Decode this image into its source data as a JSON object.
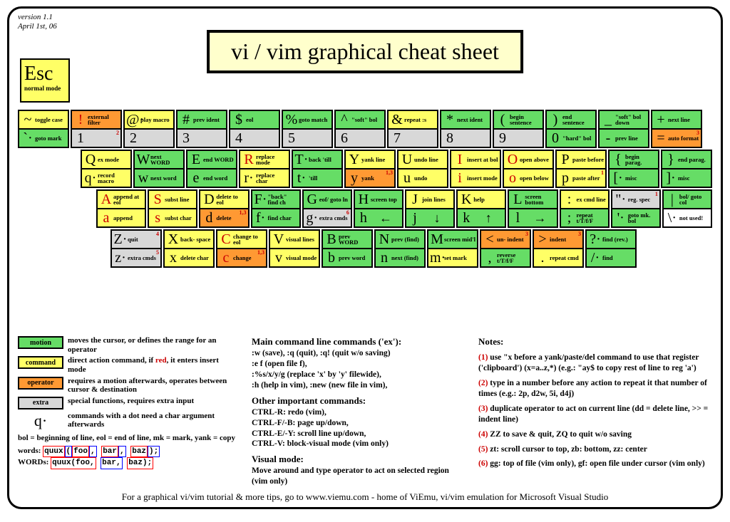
{
  "version": "version 1.1",
  "date": "April 1st, 06",
  "title": "vi / vim graphical cheat sheet",
  "esc": {
    "key": "Esc",
    "label": "normal mode"
  },
  "rows": [
    [
      {
        "t": {
          "ch": "~",
          "d": "toggle case",
          "c": "command"
        },
        "b": {
          "ch": "`·",
          "d": "goto mark",
          "c": "motion"
        }
      },
      {
        "t": {
          "ch": "!",
          "d": "external filter",
          "c": "operator",
          "red": 1
        },
        "b": {
          "ch": "1",
          "d": "",
          "c": "extra",
          "sup": "2"
        }
      },
      {
        "t": {
          "ch": "@·",
          "d": "play macro",
          "c": "command"
        },
        "b": {
          "ch": "2",
          "d": "",
          "c": "extra"
        }
      },
      {
        "t": {
          "ch": "#",
          "d": "prev ident",
          "c": "motion"
        },
        "b": {
          "ch": "3",
          "d": "",
          "c": "extra"
        }
      },
      {
        "t": {
          "ch": "$",
          "d": "eol",
          "c": "motion"
        },
        "b": {
          "ch": "4",
          "d": "",
          "c": "extra"
        }
      },
      {
        "t": {
          "ch": "%",
          "d": "goto match",
          "c": "motion"
        },
        "b": {
          "ch": "5",
          "d": "",
          "c": "extra"
        }
      },
      {
        "t": {
          "ch": "^",
          "d": "\"soft\" bol",
          "c": "motion"
        },
        "b": {
          "ch": "6",
          "d": "",
          "c": "extra"
        }
      },
      {
        "t": {
          "ch": "&",
          "d": "repeat :s",
          "c": "command"
        },
        "b": {
          "ch": "7",
          "d": "",
          "c": "extra"
        }
      },
      {
        "t": {
          "ch": "*",
          "d": "next ident",
          "c": "motion"
        },
        "b": {
          "ch": "8",
          "d": "",
          "c": "extra"
        }
      },
      {
        "t": {
          "ch": "(",
          "d": "begin sentence",
          "c": "motion"
        },
        "b": {
          "ch": "9",
          "d": "",
          "c": "extra"
        }
      },
      {
        "t": {
          "ch": ")",
          "d": "end sentence",
          "c": "motion"
        },
        "b": {
          "ch": "0",
          "d": "\"hard\" bol",
          "c": "motion"
        }
      },
      {
        "t": {
          "ch": "_",
          "d": "\"soft\" bol down",
          "c": "motion"
        },
        "b": {
          "ch": "-",
          "d": "prev line",
          "c": "motion"
        }
      },
      {
        "t": {
          "ch": "+",
          "d": "next line",
          "c": "motion"
        },
        "b": {
          "ch": "=",
          "d": "auto format",
          "c": "operator",
          "sup": "3"
        }
      }
    ],
    [
      {
        "t": {
          "ch": "Q",
          "d": "ex mode",
          "c": "command"
        },
        "b": {
          "ch": "q·",
          "d": "record macro",
          "c": "command"
        }
      },
      {
        "t": {
          "ch": "W",
          "d": "next WORD",
          "c": "motion"
        },
        "b": {
          "ch": "w",
          "d": "next word",
          "c": "motion"
        }
      },
      {
        "t": {
          "ch": "E",
          "d": "end WORD",
          "c": "motion"
        },
        "b": {
          "ch": "e",
          "d": "end word",
          "c": "motion"
        }
      },
      {
        "t": {
          "ch": "R",
          "d": "replace mode",
          "c": "command",
          "red": 1
        },
        "b": {
          "ch": "r·",
          "d": "replace char",
          "c": "command"
        }
      },
      {
        "t": {
          "ch": "T·",
          "d": "back 'till",
          "c": "motion"
        },
        "b": {
          "ch": "t·",
          "d": "'till",
          "c": "motion"
        }
      },
      {
        "t": {
          "ch": "Y",
          "d": "yank line",
          "c": "command"
        },
        "b": {
          "ch": "y",
          "d": "yank",
          "c": "operator",
          "sup": "1,3"
        }
      },
      {
        "t": {
          "ch": "U",
          "d": "undo line",
          "c": "command"
        },
        "b": {
          "ch": "u",
          "d": "undo",
          "c": "command"
        }
      },
      {
        "t": {
          "ch": "I",
          "d": "insert at bol",
          "c": "command",
          "red": 1
        },
        "b": {
          "ch": "i",
          "d": "insert mode",
          "c": "command",
          "red": 1
        }
      },
      {
        "t": {
          "ch": "O",
          "d": "open above",
          "c": "command",
          "red": 1
        },
        "b": {
          "ch": "o",
          "d": "open below",
          "c": "command",
          "red": 1
        }
      },
      {
        "t": {
          "ch": "P",
          "d": "paste before",
          "c": "command"
        },
        "b": {
          "ch": "p",
          "d": "paste after",
          "c": "command",
          "sup": "1"
        }
      },
      {
        "t": {
          "ch": "{",
          "d": "begin parag.",
          "c": "motion"
        },
        "b": {
          "ch": "[·",
          "d": "misc",
          "c": "motion"
        }
      },
      {
        "t": {
          "ch": "}",
          "d": "end parag.",
          "c": "motion"
        },
        "b": {
          "ch": "]·",
          "d": "misc",
          "c": "motion"
        }
      }
    ],
    [
      {
        "t": {
          "ch": "A",
          "d": "append at eol",
          "c": "command",
          "red": 1
        },
        "b": {
          "ch": "a",
          "d": "append",
          "c": "command",
          "red": 1
        }
      },
      {
        "t": {
          "ch": "S",
          "d": "subst line",
          "c": "command",
          "red": 1
        },
        "b": {
          "ch": "s",
          "d": "subst char",
          "c": "command",
          "red": 1
        }
      },
      {
        "t": {
          "ch": "D",
          "d": "delete to eol",
          "c": "command"
        },
        "b": {
          "ch": "d",
          "d": "delete",
          "c": "operator",
          "sup": "1,3"
        }
      },
      {
        "t": {
          "ch": "F·",
          "d": "\"back\" find ch",
          "c": "motion"
        },
        "b": {
          "ch": "f·",
          "d": "find char",
          "c": "motion"
        }
      },
      {
        "t": {
          "ch": "G",
          "d": "eof/ goto ln",
          "c": "motion"
        },
        "b": {
          "ch": "g·",
          "d": "extra cmds",
          "c": "extra",
          "sup": "6"
        }
      },
      {
        "t": {
          "ch": "H",
          "d": "screen top",
          "c": "motion"
        },
        "b": {
          "ch": "h",
          "d": "",
          "c": "motion",
          "arrow": "←"
        }
      },
      {
        "t": {
          "ch": "J",
          "d": "join lines",
          "c": "command"
        },
        "b": {
          "ch": "j",
          "d": "",
          "c": "motion",
          "arrow": "↓"
        }
      },
      {
        "t": {
          "ch": "K",
          "d": "help",
          "c": "command"
        },
        "b": {
          "ch": "k",
          "d": "",
          "c": "motion",
          "arrow": "↑"
        }
      },
      {
        "t": {
          "ch": "L",
          "d": "screen bottom",
          "c": "motion"
        },
        "b": {
          "ch": "l",
          "d": "",
          "c": "motion",
          "arrow": "→"
        }
      },
      {
        "t": {
          "ch": ":",
          "d": "ex cmd line",
          "c": "command"
        },
        "b": {
          "ch": ";",
          "d": "repeat t/T/f/F",
          "c": "motion"
        }
      },
      {
        "t": {
          "ch": "\"·",
          "d": "reg. spec",
          "c": "extra",
          "sup": "1"
        },
        "b": {
          "ch": "'·",
          "d": "goto mk. bol",
          "c": "motion"
        }
      },
      {
        "t": {
          "ch": "|",
          "d": "bol/ goto col",
          "c": "motion"
        },
        "b": {
          "ch": "\\·",
          "d": "not used!",
          "c": "white"
        }
      }
    ],
    [
      {
        "t": {
          "ch": "Z·",
          "d": "quit",
          "c": "extra",
          "sup": "4"
        },
        "b": {
          "ch": "z·",
          "d": "extra cmds",
          "c": "extra",
          "sup": "5"
        }
      },
      {
        "t": {
          "ch": "X",
          "d": "back- space",
          "c": "command"
        },
        "b": {
          "ch": "x",
          "d": "delete char",
          "c": "command"
        }
      },
      {
        "t": {
          "ch": "C",
          "d": "change to eol",
          "c": "command",
          "red": 1
        },
        "b": {
          "ch": "c",
          "d": "change",
          "c": "operator",
          "red": 1,
          "sup": "1,3"
        }
      },
      {
        "t": {
          "ch": "V",
          "d": "visual lines",
          "c": "command"
        },
        "b": {
          "ch": "v",
          "d": "visual mode",
          "c": "command"
        }
      },
      {
        "t": {
          "ch": "B",
          "d": "prev WORD",
          "c": "motion"
        },
        "b": {
          "ch": "b",
          "d": "prev word",
          "c": "motion"
        }
      },
      {
        "t": {
          "ch": "N",
          "d": "prev (find)",
          "c": "motion"
        },
        "b": {
          "ch": "n",
          "d": "next (find)",
          "c": "motion"
        }
      },
      {
        "t": {
          "ch": "M",
          "d": "screen mid'l",
          "c": "motion"
        },
        "b": {
          "ch": "m·",
          "d": "set mark",
          "c": "command"
        }
      },
      {
        "t": {
          "ch": "<",
          "d": "un- indent",
          "c": "operator",
          "sup": "3"
        },
        "b": {
          "ch": ",",
          "d": "reverse t/T/f/F",
          "c": "motion"
        }
      },
      {
        "t": {
          "ch": ">",
          "d": "indent",
          "c": "operator",
          "sup": "3"
        },
        "b": {
          "ch": ".",
          "d": "repeat cmd",
          "c": "command"
        }
      },
      {
        "t": {
          "ch": "?·",
          "d": "find (rev.)",
          "c": "motion"
        },
        "b": {
          "ch": "/·",
          "d": "find",
          "c": "motion"
        }
      }
    ]
  ],
  "legend": [
    {
      "name": "motion",
      "c": "motion",
      "text": "moves the cursor, or defines the range for an operator"
    },
    {
      "name": "command",
      "c": "command",
      "text": "direct action command, if |red|, it enters insert mode"
    },
    {
      "name": "operator",
      "c": "operator",
      "text": "requires a motion afterwards, operates between cursor & destination"
    },
    {
      "name": "extra",
      "c": "extra",
      "text": "special functions, requires extra input"
    }
  ],
  "qdot": "commands with a dot need a char argument afterwards",
  "abbrev": "bol = beginning of line, eol = end of line, mk = mark, yank = copy",
  "words_label": "words:",
  "WORDS_label": "WORDs:",
  "col2": {
    "h1": "Main command line commands ('ex'):",
    "p1": ":w (save), :q (quit), :q! (quit w/o saving)\n:e f (open file f),\n:%s/x/y/g (replace 'x' by 'y' filewide),\n:h (help in vim), :new (new file in vim),",
    "h2": "Other important commands:",
    "p2": "CTRL-R: redo (vim),\nCTRL-F/-B: page up/down,\nCTRL-E/-Y: scroll line up/down,\nCTRL-V: block-visual mode (vim only)",
    "h3": "Visual mode:",
    "p3": "Move around and type operator to act on selected region (vim only)"
  },
  "notes_h": "Notes:",
  "notes": [
    "use \"x before a yank/paste/del command to use that register ('clipboard') (x=a..z,*) (e.g.: \"ay$ to copy rest of line to reg 'a')",
    "type in a number before any action to repeat it that number of times (e.g.: 2p, d2w, 5i, d4j)",
    "duplicate operator to act on current line (dd = delete line, >> = indent line)",
    "ZZ to save & quit, ZQ to quit w/o saving",
    "zt: scroll cursor to top, zb: bottom, zz: center",
    "gg: top of file (vim only), gf: open file under cursor (vim only)"
  ],
  "footer": "For a graphical vi/vim tutorial & more tips, go to   www.viemu.com   - home of ViEmu, vi/vim emulation for Microsoft Visual Studio"
}
